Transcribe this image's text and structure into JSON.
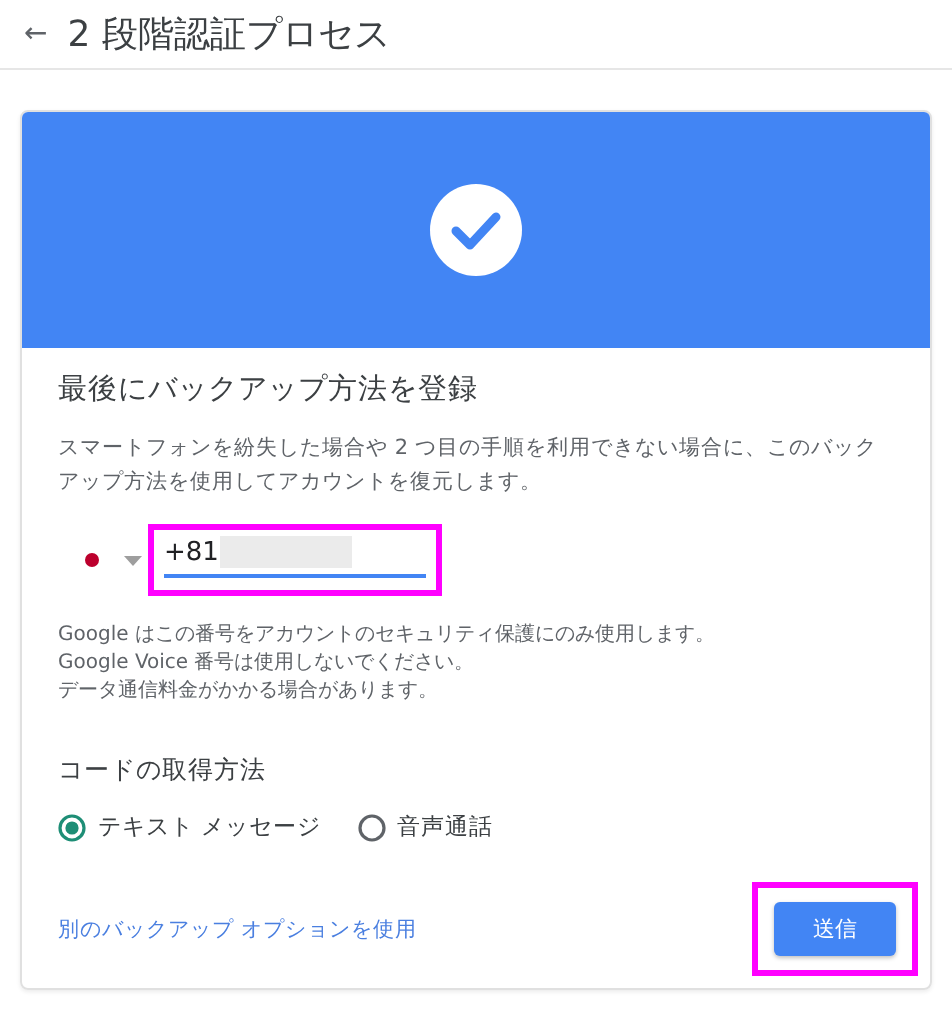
{
  "header": {
    "back_icon": "←",
    "title": "2 段階認証プロセス"
  },
  "card": {
    "heading": "最後にバックアップ方法を登録",
    "description": "スマートフォンを紛失した場合や 2 つ目の手順を利用できない場合に、このバックアップ方法を使用してアカウントを復元します。",
    "phone": {
      "value": "+81",
      "redacted": true,
      "highlighted": true
    },
    "notes": [
      "Google はこの番号をアカウントのセキュリティ保護にのみ使用します。",
      "Google Voice 番号は使用しないでください。",
      "データ通信料金がかかる場合があります。"
    ],
    "code_method_label": "コードの取得方法",
    "options": [
      {
        "label": "テキスト メッセージ",
        "selected": true
      },
      {
        "label": "音声通話",
        "selected": false
      }
    ],
    "alt_link": "別のバックアップ オプションを使用",
    "send_button": {
      "label": "送信",
      "highlighted": true
    }
  }
}
